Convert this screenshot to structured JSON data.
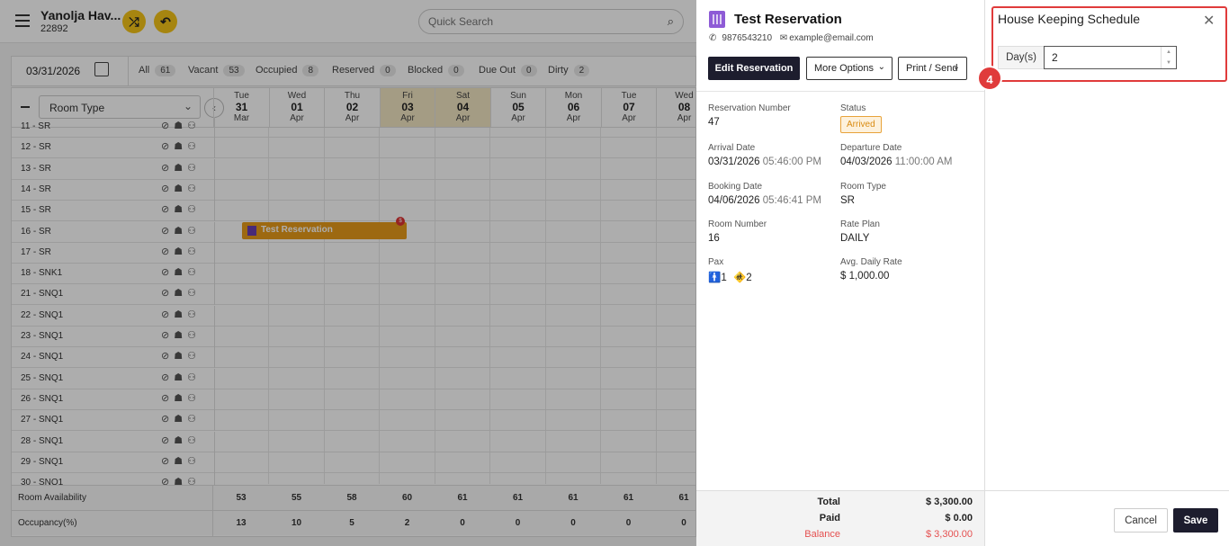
{
  "app": {
    "property_name": "Yanolja Hav...",
    "property_id": "22892",
    "search_placeholder": "Quick Search"
  },
  "filters": {
    "date": "03/31/2026",
    "chips": [
      {
        "label": "All",
        "count": "61"
      },
      {
        "label": "Vacant",
        "count": "53"
      },
      {
        "label": "Occupied",
        "count": "8"
      },
      {
        "label": "Reserved",
        "count": "0"
      },
      {
        "label": "Blocked",
        "count": "0"
      },
      {
        "label": "Due Out",
        "count": "0"
      },
      {
        "label": "Dirty",
        "count": "2"
      }
    ]
  },
  "grid": {
    "room_type_select": "Room Type",
    "days": [
      {
        "dow": "Tue",
        "day": "31",
        "mon": "Mar",
        "weekend": false
      },
      {
        "dow": "Wed",
        "day": "01",
        "mon": "Apr",
        "weekend": false
      },
      {
        "dow": "Thu",
        "day": "02",
        "mon": "Apr",
        "weekend": false
      },
      {
        "dow": "Fri",
        "day": "03",
        "mon": "Apr",
        "weekend": true
      },
      {
        "dow": "Sat",
        "day": "04",
        "mon": "Apr",
        "weekend": true
      },
      {
        "dow": "Sun",
        "day": "05",
        "mon": "Apr",
        "weekend": false
      },
      {
        "dow": "Mon",
        "day": "06",
        "mon": "Apr",
        "weekend": false
      },
      {
        "dow": "Tue",
        "day": "07",
        "mon": "Apr",
        "weekend": false
      },
      {
        "dow": "Wed",
        "day": "08",
        "mon": "Apr",
        "weekend": false
      }
    ],
    "rooms": [
      "11 - SR",
      "12 - SR",
      "13 - SR",
      "14 - SR",
      "15 - SR",
      "16 - SR",
      "17 - SR",
      "18 - SNK1",
      "21 - SNQ1",
      "22 - SNQ1",
      "23 - SNQ1",
      "24 - SNQ1",
      "25 - SNQ1",
      "26 - SNQ1",
      "27 - SNQ1",
      "28 - SNQ1",
      "29 - SNQ1",
      "30 - SNQ1"
    ],
    "reservation_bar": {
      "label": "Test Reservation",
      "badge": "$"
    },
    "availability": {
      "label": "Room Availability",
      "values": [
        "53",
        "55",
        "58",
        "60",
        "61",
        "61",
        "61",
        "61",
        "61"
      ]
    },
    "occupancy": {
      "label": "Occupancy(%)",
      "values": [
        "13",
        "10",
        "5",
        "2",
        "0",
        "0",
        "0",
        "0",
        "0"
      ]
    }
  },
  "reservation": {
    "title": "Test Reservation",
    "phone": "9876543210",
    "email": "example@email.com",
    "buttons": {
      "edit": "Edit Reservation",
      "more": "More Options",
      "print": "Print / Send"
    },
    "fields": {
      "number_label": "Reservation Number",
      "number": "47",
      "status_label": "Status",
      "status": "Arrived",
      "arrival_label": "Arrival Date",
      "arrival_date": "03/31/2026",
      "arrival_time": "05:46:00 PM",
      "departure_label": "Departure Date",
      "departure_date": "04/03/2026",
      "departure_time": "11:00:00 AM",
      "booking_label": "Booking Date",
      "booking_date": "04/06/2026",
      "booking_time": "05:46:41 PM",
      "room_type_label": "Room Type",
      "room_type": "SR",
      "room_number_label": "Room Number",
      "room_number": "16",
      "rate_plan_label": "Rate Plan",
      "rate_plan": "DAILY",
      "pax_label": "Pax",
      "adults": "1",
      "children": "2",
      "adr_label": "Avg. Daily Rate",
      "adr": "$ 1,000.00"
    },
    "totals": {
      "total_label": "Total",
      "total": "$ 3,300.00",
      "paid_label": "Paid",
      "paid": "$ 0.00",
      "balance_label": "Balance",
      "balance": "$ 3,300.00"
    }
  },
  "housekeeping": {
    "title": "House Keeping Schedule",
    "days_label": "Day(s)",
    "days_value": "2",
    "step_badge": "4",
    "cancel": "Cancel",
    "save": "Save"
  },
  "colors": {
    "accent_dark": "#1d1d2e",
    "highlight_red": "#e03b3b",
    "status_orange": "#e8a33a",
    "reservation_bar": "#e89b1a"
  }
}
